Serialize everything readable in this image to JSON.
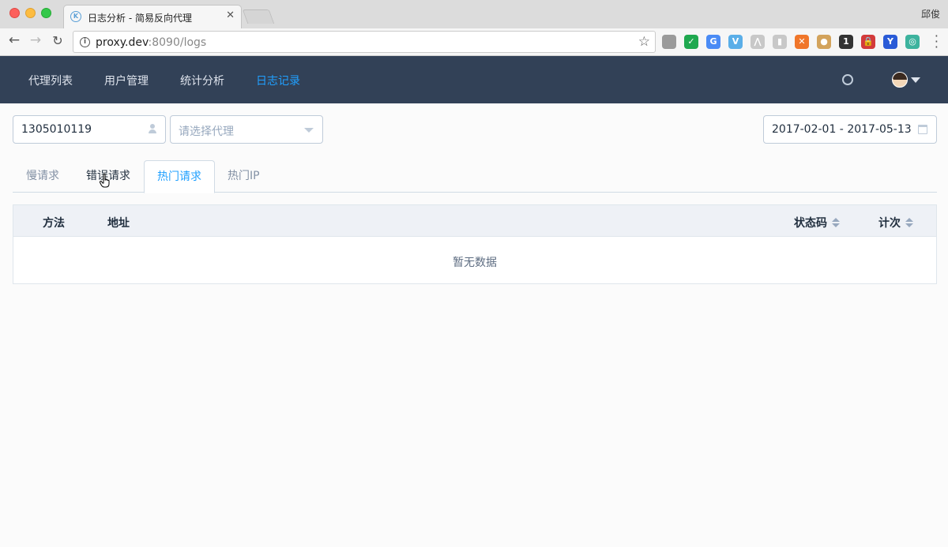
{
  "browser": {
    "tab_title": "日志分析 - 简易反向代理",
    "tab_favicon": "K",
    "tab_close": "✕",
    "profile_name": "邱俊",
    "url_host": "proxy.dev",
    "url_rest": ":8090/logs",
    "nav": {
      "back": "←",
      "forward": "→",
      "reload": "↻"
    },
    "star": "☆",
    "extensions": [
      {
        "icon": "circle-extension-icon",
        "glyph": "",
        "color": "#9a9a9a"
      },
      {
        "icon": "shield-extension-icon",
        "glyph": "✓",
        "color": "#1fa84f"
      },
      {
        "icon": "translate-extension-icon",
        "glyph": "G",
        "color": "#4a8bf5"
      },
      {
        "icon": "vimeo-extension-icon",
        "glyph": "V",
        "color": "#5aaee8"
      },
      {
        "icon": "tree-extension-icon",
        "glyph": "⋀",
        "color": "#c8c8c8"
      },
      {
        "icon": "mic-extension-icon",
        "glyph": "▮",
        "color": "#c8c8c8"
      },
      {
        "icon": "orange-extension-icon",
        "glyph": "✕",
        "color": "#f0762a"
      },
      {
        "icon": "cookie-extension-icon",
        "glyph": "●",
        "color": "#d3a35c"
      },
      {
        "icon": "badge-extension-icon",
        "glyph": "1",
        "color": "#333333"
      },
      {
        "icon": "lock-extension-icon",
        "glyph": "🔒",
        "color": "#d33b3b"
      },
      {
        "icon": "y-extension-icon",
        "glyph": "Y",
        "color": "#2a5bd7"
      },
      {
        "icon": "globe-extension-icon",
        "glyph": "◎",
        "color": "#3db39e"
      }
    ]
  },
  "app_nav": {
    "items": [
      {
        "label": "代理列表",
        "active": false
      },
      {
        "label": "用户管理",
        "active": false
      },
      {
        "label": "统计分析",
        "active": false
      },
      {
        "label": "日志记录",
        "active": true
      }
    ]
  },
  "filters": {
    "user_value": "1305010119",
    "proxy_placeholder": "请选择代理",
    "date_range": "2017-02-01 - 2017-05-13"
  },
  "tabs": [
    {
      "label": "慢请求",
      "state": "normal"
    },
    {
      "label": "错误请求",
      "state": "hover"
    },
    {
      "label": "热门请求",
      "state": "active"
    },
    {
      "label": "热门IP",
      "state": "normal"
    }
  ],
  "table": {
    "columns": {
      "method": "方法",
      "address": "地址",
      "status_code": "状态码",
      "count": "计次"
    },
    "empty_text": "暂无数据"
  },
  "colors": {
    "nav_bg": "#324157",
    "accent": "#20a0ff",
    "border": "#bfcbd9"
  }
}
